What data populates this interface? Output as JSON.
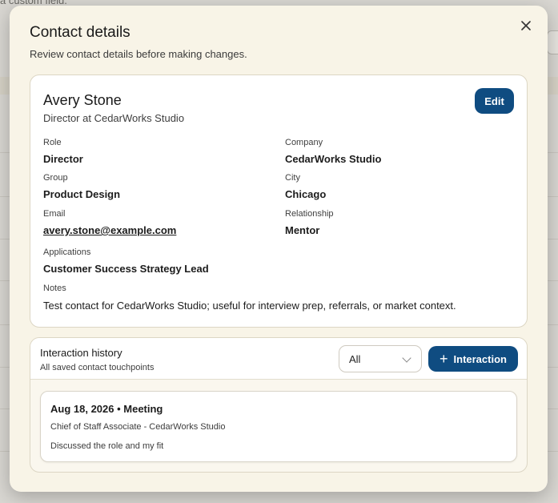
{
  "background": {
    "hint_text": "a custom field."
  },
  "modal": {
    "title": "Contact details",
    "subtitle": "Review contact details before making changes.",
    "close_icon": "close-icon"
  },
  "contact": {
    "name": "Avery Stone",
    "headline": "Director at CedarWorks Studio",
    "edit_label": "Edit",
    "fields": {
      "role": {
        "label": "Role",
        "value": "Director"
      },
      "company": {
        "label": "Company",
        "value": "CedarWorks Studio"
      },
      "group": {
        "label": "Group",
        "value": "Product Design"
      },
      "city": {
        "label": "City",
        "value": "Chicago"
      },
      "email": {
        "label": "Email",
        "value": "avery.stone@example.com"
      },
      "relationship": {
        "label": "Relationship",
        "value": "Mentor"
      },
      "applications": {
        "label": "Applications",
        "value": "Customer Success Strategy Lead"
      },
      "notes": {
        "label": "Notes",
        "value": "Test contact for CedarWorks Studio; useful for interview prep, referrals, or market context."
      }
    }
  },
  "history": {
    "title": "Interaction history",
    "subtitle": "All saved contact touchpoints",
    "filter_value": "All",
    "add_label": "Interaction",
    "entries": [
      {
        "title": "Aug 18, 2026 • Meeting",
        "subtitle": "Chief of Staff Associate - CedarWorks Studio",
        "note": "Discussed the role and my fit"
      }
    ]
  },
  "colors": {
    "accent": "#0f4c81",
    "modal_bg": "#f8f4e7",
    "card_border": "#dcd6c4"
  }
}
